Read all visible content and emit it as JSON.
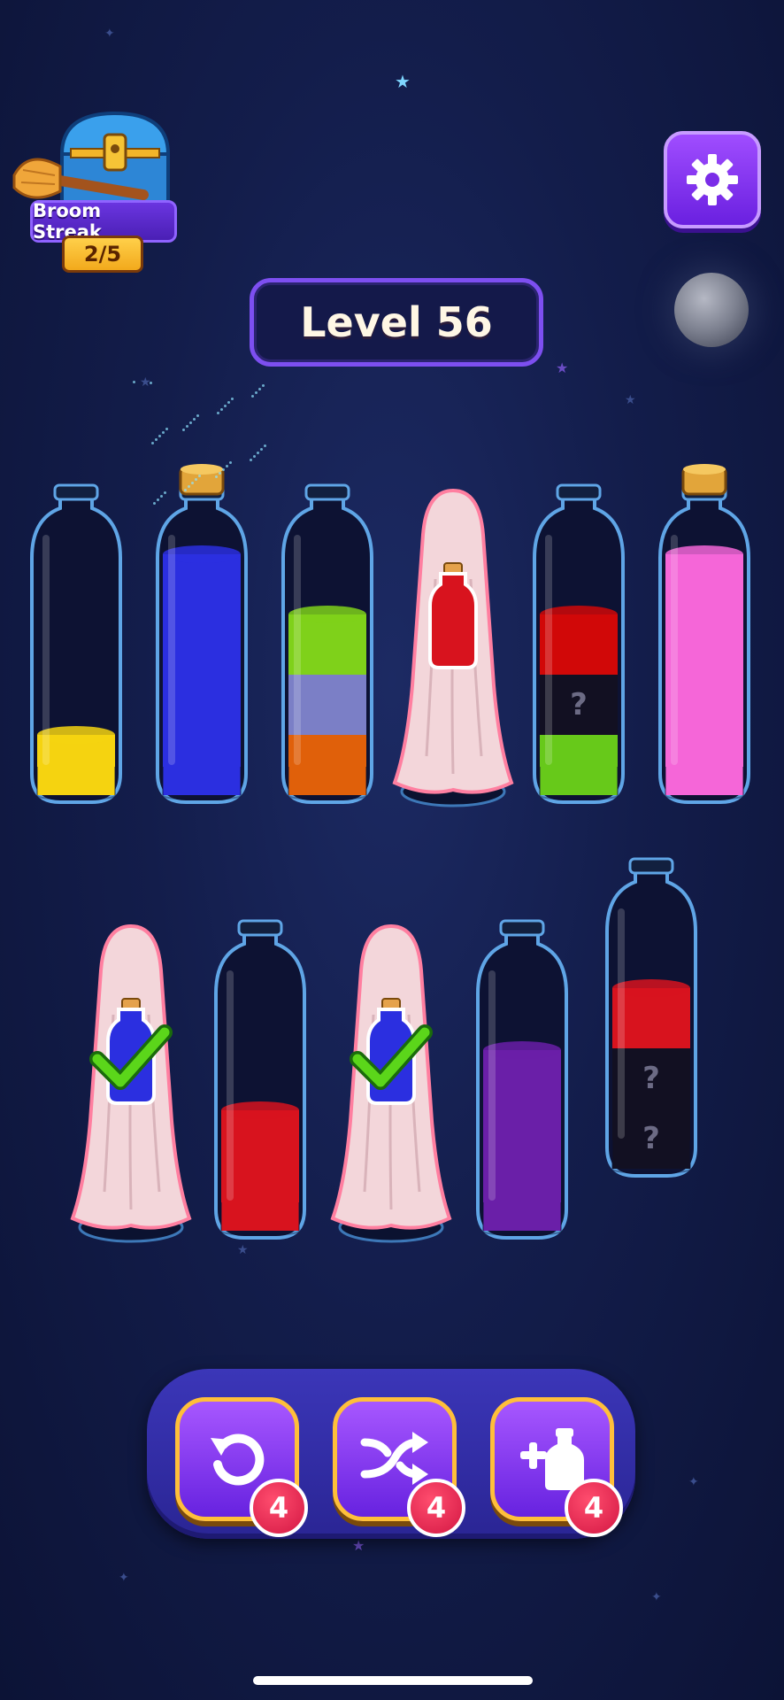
{
  "streak": {
    "label": "Broom Streak",
    "progress": "2/5"
  },
  "level": {
    "label": "Level 56"
  },
  "settings": {
    "icon": "gear-icon"
  },
  "bottles_row1": [
    {
      "name": "bottle-1",
      "cap": "none",
      "layers": [
        "#f5d310"
      ],
      "hidden": 0
    },
    {
      "name": "bottle-2",
      "cap": "cork",
      "layers": [
        "#2b2fe0",
        "#2b2fe0",
        "#2b2fe0",
        "#2b2fe0"
      ],
      "hidden": 0,
      "completed": true
    },
    {
      "name": "bottle-3",
      "cap": "none",
      "layers": [
        "#e0600a",
        "#7b7fc6",
        "#7fd11a"
      ],
      "hidden": 0
    },
    {
      "name": "bottle-4",
      "cap": "cloth",
      "cloth_icon": "red-potion-icon"
    },
    {
      "name": "bottle-5",
      "cap": "none",
      "layers": [
        "#67c91a",
        "unknown",
        "#d10808"
      ],
      "hidden": 1
    },
    {
      "name": "bottle-6",
      "cap": "cork",
      "layers": [
        "#f566d8",
        "#f566d8",
        "#f566d8",
        "#f566d8"
      ],
      "hidden": 0,
      "completed": true
    }
  ],
  "bottles_row2": [
    {
      "name": "bottle-7",
      "cap": "cloth",
      "cloth_icon": "blue-potion-check-icon"
    },
    {
      "name": "bottle-8",
      "cap": "none",
      "layers": [
        "#d8131e",
        "#d8131e"
      ],
      "hidden": 0
    },
    {
      "name": "bottle-9",
      "cap": "cloth",
      "cloth_icon": "blue-potion-check-icon"
    },
    {
      "name": "bottle-10",
      "cap": "none",
      "layers": [
        "#6a1fa8",
        "#6a1fa8",
        "#6a1fa8"
      ],
      "hidden": 0
    },
    {
      "name": "bottle-11",
      "cap": "none",
      "layers": [
        "unknown",
        "unknown",
        "#d8131e"
      ],
      "hidden": 2
    }
  ],
  "unknown_mark": "?",
  "toolbar": {
    "undo": {
      "icon": "undo-icon",
      "count": "4"
    },
    "shuffle": {
      "icon": "shuffle-icon",
      "count": "4"
    },
    "add_bottle": {
      "icon": "add-bottle-icon",
      "count": "4"
    }
  }
}
